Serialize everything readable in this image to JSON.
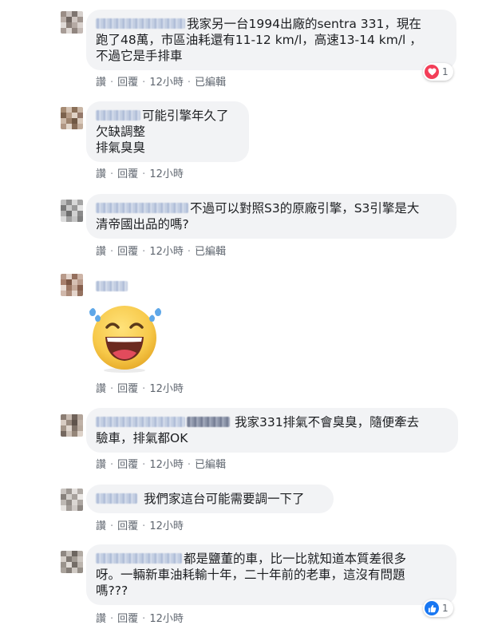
{
  "colors": {
    "bubble_bg": "#f2f3f5",
    "action_text": "#606770",
    "love_red": "#f33e58",
    "like_blue": "#1877f2"
  },
  "comments": [
    {
      "text_lines": [
        "我家另一台1994出廠的sentra 331，現在",
        "跑了48萬，市區油耗還有11-12 km/l，高速13-14 km/l ，",
        "不過它是手排車"
      ],
      "actions": {
        "like": "讚",
        "reply": "回覆",
        "time": "12小時",
        "edited": "已編輯"
      },
      "reaction": {
        "icon": "love-icon",
        "count": "1"
      }
    },
    {
      "text_lines": [
        "可能引擎年久了",
        "欠缺調整",
        "排氣臭臭"
      ],
      "actions": {
        "like": "讚",
        "reply": "回覆",
        "time": "12小時"
      }
    },
    {
      "text_lines": [
        "不過可以對照S3的原廠引擎，S3引擎是大",
        "清帝國出品的嗎?"
      ],
      "actions": {
        "like": "讚",
        "reply": "回覆",
        "time": "12小時",
        "edited": "已編輯"
      }
    },
    {
      "sticker": "laughing-tears-emoji",
      "actions": {
        "like": "讚",
        "reply": "回覆",
        "time": "12小時"
      }
    },
    {
      "text_lines": [
        "我家331排氣不會臭臭，隨便牽去",
        "驗車，排氣都OK"
      ],
      "actions": {
        "like": "讚",
        "reply": "回覆",
        "time": "12小時",
        "edited": "已編輯"
      }
    },
    {
      "text_lines": [
        "我們家這台可能需要調一下了"
      ],
      "actions": {
        "like": "讚",
        "reply": "回覆",
        "time": "12小時"
      }
    },
    {
      "text_lines": [
        "都是鹽董的車，比一比就知道本質差很多",
        "呀。一輛新車油耗輸十年，二十年前的老車，這沒有問題",
        "嗎???"
      ],
      "actions": {
        "like": "讚",
        "reply": "回覆",
        "time": "12小時"
      },
      "reaction": {
        "icon": "thumbs-up-icon",
        "count": "1"
      }
    }
  ]
}
